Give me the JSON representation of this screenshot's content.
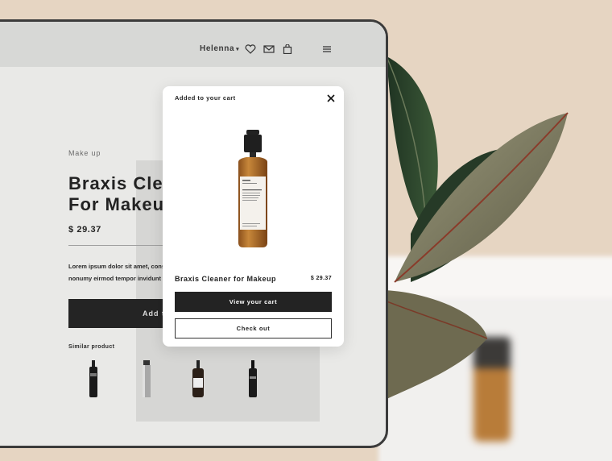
{
  "header": {
    "account_label": "Helenna",
    "account_caret": "▾"
  },
  "product": {
    "category": "Make up",
    "title_line1": "Braxis Cle",
    "title_line2": "For Makeu",
    "price": "$ 29.37",
    "desc_line1": "Lorem ipsum dolor sit amet, conse",
    "desc_line2": "nonumy eirmod tempor invidunt u",
    "add_button": "Add to"
  },
  "similar": {
    "label": "Similar product"
  },
  "modal": {
    "title": "Added to your cart",
    "product_name": "Braxis Cleaner for Makeup",
    "price": "$ 29.37",
    "view_cart": "View your cart",
    "checkout": "Check out"
  },
  "colors": {
    "accent_dark": "#232323",
    "background": "#e6d5c2",
    "amber_bottle": "#b4732b"
  },
  "icons": [
    "heart-icon",
    "mail-icon",
    "bag-icon",
    "menu-icon",
    "close-icon"
  ]
}
